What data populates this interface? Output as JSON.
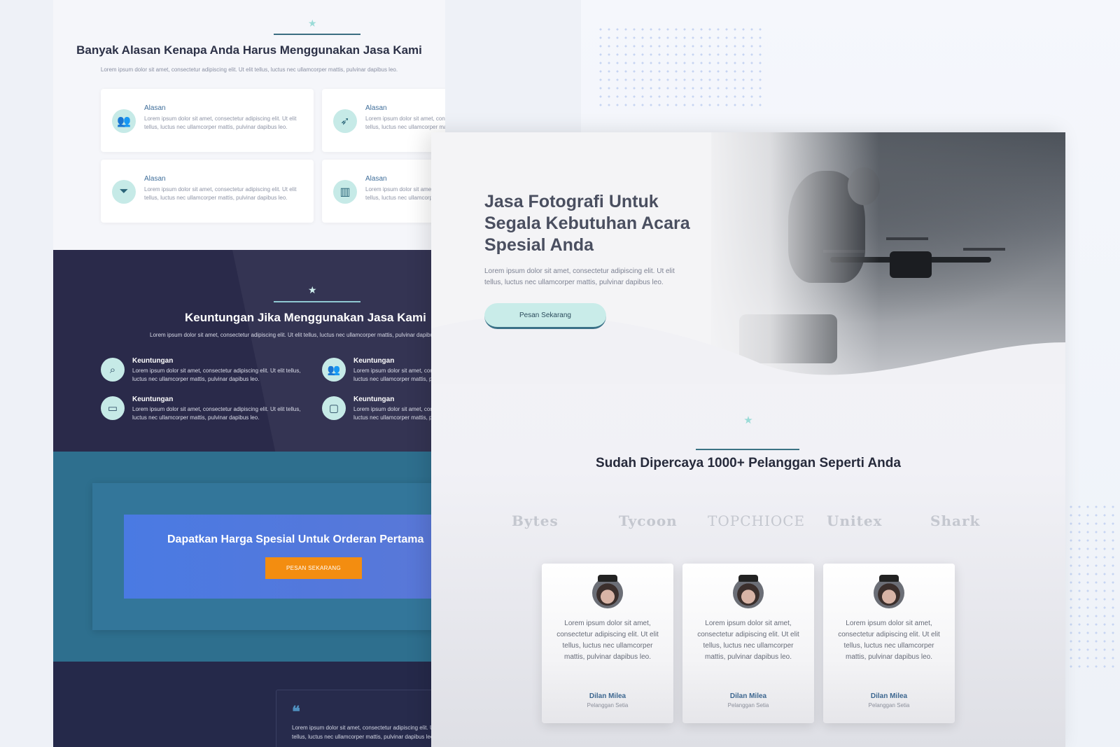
{
  "colors": {
    "accent": "#9adbd7",
    "dark_bg": "#2a2a4a",
    "teal_bg": "#2e6f8e",
    "blue_bg": "#4a7ae3",
    "orange": "#f38d10",
    "link": "#3f6e9a"
  },
  "page1": {
    "title": "Banyak Alasan Kenapa Anda Harus Menggunakan Jasa Kami",
    "subtitle": "Lorem ipsum dolor sit amet, consectetur adipiscing elit. Ut elit tellus, luctus nec ullamcorper mattis, pulvinar dapibus leo.",
    "cards": [
      {
        "title": "Alasan",
        "desc": "Lorem ipsum dolor sit amet, consectetur adipiscing elit. Ut elit tellus, luctus nec ullamcorper mattis, pulvinar dapibus leo.",
        "icon": "users-icon",
        "glyph": "👥"
      },
      {
        "title": "Alasan",
        "desc": "Lorem ipsum dolor sit amet, consectetur adipiscing elit. Ut elit tellus, luctus nec ullamcorper mattis, pulvinar dapibus leo.",
        "icon": "paper-plane-icon",
        "glyph": "➶"
      },
      {
        "title": "Alasan",
        "desc": "Lorem ipsum dolor sit amet, consectetur adipiscing elit. Ut elit tellus, luctus nec ullamcorper mattis, pulvinar dapibus leo.",
        "icon": "filter-dollar-icon",
        "glyph": "⏷"
      },
      {
        "title": "Alasan",
        "desc": "Lorem ipsum dolor sit amet, consectetur adipiscing elit. Ut elit tellus, luctus nec ullamcorper mattis, pulvinar dapibus leo.",
        "icon": "bar-chart-icon",
        "glyph": "▥"
      }
    ],
    "dark": {
      "title": "Keuntungan Jika Menggunakan Jasa Kami",
      "subtitle": "Lorem ipsum dolor sit amet, consectetur adipiscing elit. Ut elit tellus, luctus nec ullamcorper mattis, pulvinar dapibus leo.",
      "items": [
        {
          "title": "Keuntungan",
          "desc": "Lorem ipsum dolor sit amet, consectetur adipiscing elit. Ut elit tellus, luctus nec ullamcorper mattis, pulvinar dapibus leo.",
          "icon": "search-icon",
          "glyph": "⌕"
        },
        {
          "title": "Keuntungan",
          "desc": "Lorem ipsum dolor sit amet, consectetur adipiscing elit. Ut elit tellus, luctus nec ullamcorper mattis, pulvinar dapibus leo.",
          "icon": "meeting-icon",
          "glyph": "👥"
        },
        {
          "title": "Keuntungan",
          "desc": "Lorem ipsum dolor sit amet, consectetur adipiscing elit. Ut elit tellus, luctus nec ullamcorper mattis, pulvinar dapibus leo.",
          "icon": "laptop-check-icon",
          "glyph": "▭"
        },
        {
          "title": "Keuntungan",
          "desc": "Lorem ipsum dolor sit amet, consectetur adipiscing elit. Ut elit tellus, luctus nec ullamcorper mattis, pulvinar dapibus leo.",
          "icon": "chat-shield-icon",
          "glyph": "▢"
        }
      ]
    },
    "promo": {
      "title": "Dapatkan Harga Spesial Untuk Orderan Pertama",
      "button": "PESAN SEKARANG"
    },
    "quote": {
      "text": "Lorem ipsum dolor sit amet, consectetur adipiscing elit. Ut elit tellus, luctus nec ullamcorper mattis, pulvinar dapibus leo."
    }
  },
  "page2": {
    "hero_title": "Jasa Fotografi Untuk Segala Kebutuhan Acara Spesial Anda",
    "hero_desc": "Lorem ipsum dolor sit amet, consectetur adipiscing elit. Ut elit tellus, luctus nec ullamcorper mattis, pulvinar dapibus leo.",
    "hero_button": "Pesan Sekarang",
    "trusted_title": "Sudah Dipercaya 1000+ Pelanggan Seperti Anda",
    "logos": [
      "Bytes",
      "Tycoon",
      "TOPCHIOCE",
      "Unitex",
      "Shark"
    ],
    "testimonials": [
      {
        "text": "Lorem ipsum dolor sit amet, consectetur adipiscing elit. Ut elit tellus, luctus nec ullamcorper mattis, pulvinar dapibus leo.",
        "name": "Dilan Milea",
        "role": "Pelanggan Setia"
      },
      {
        "text": "Lorem ipsum dolor sit amet, consectetur adipiscing elit. Ut elit tellus, luctus nec ullamcorper mattis, pulvinar dapibus leo.",
        "name": "Dilan Milea",
        "role": "Pelanggan Setia"
      },
      {
        "text": "Lorem ipsum dolor sit amet, consectetur adipiscing elit. Ut elit tellus, luctus nec ullamcorper mattis, pulvinar dapibus leo.",
        "name": "Dilan Milea",
        "role": "Pelanggan Setia"
      }
    ]
  }
}
